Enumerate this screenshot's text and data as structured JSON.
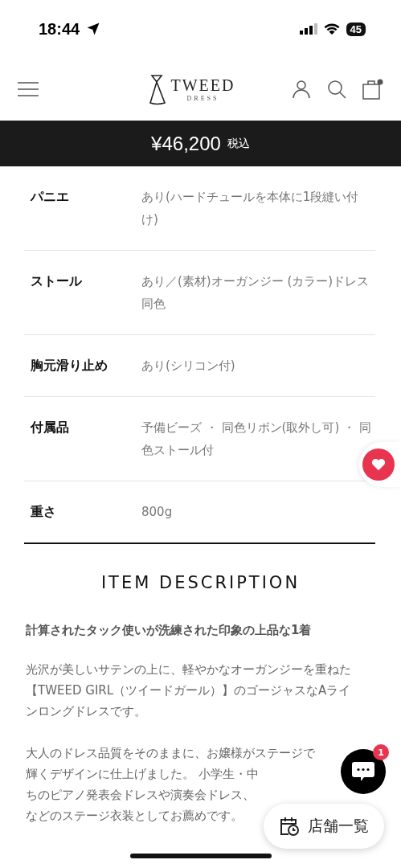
{
  "status_bar": {
    "time": "18:44",
    "battery": "45"
  },
  "header": {
    "logo": {
      "name": "TWEED",
      "sub": "DRESS"
    },
    "cart_has_items": true
  },
  "price_bar": {
    "price": "¥46,200",
    "tax_note": "税込"
  },
  "specs": [
    {
      "label": "パニエ",
      "value": "あり(ハードチュールを本体に1段縫い付け)"
    },
    {
      "label": "ストール",
      "value": "あり／(素材)オーガンジー (カラー)ドレス同色"
    },
    {
      "label": "胸元滑り止め",
      "value": "あり(シリコン付)"
    },
    {
      "label": "付属品",
      "value": "予備ビーズ ・ 同色リボン(取外し可) ・ 同色ストール付"
    },
    {
      "label": "重さ",
      "value": "800g"
    }
  ],
  "description": {
    "title": "ITEM DESCRIPTION",
    "lead": "計算されたタック使いが洗練された印象の上品な1着",
    "paragraphs": [
      [
        "光沢が美しいサテンの上に、軽やかなオーガンジーを重ねた",
        "【TWEED GIRL（ツイードガール）】のゴージャスなAライ",
        "ンロングドレスです。"
      ],
      [
        "大人のドレス品質をそのままに、お嬢様がステージで",
        "輝くデザインに仕上げました。 小学生・中",
        "ちのピアノ発表会ドレスや演奏会ドレス、",
        "などのステージ衣装としてお薦めです。"
      ]
    ]
  },
  "floating": {
    "chat_badge": "1",
    "store_button": "店舗一覧"
  }
}
